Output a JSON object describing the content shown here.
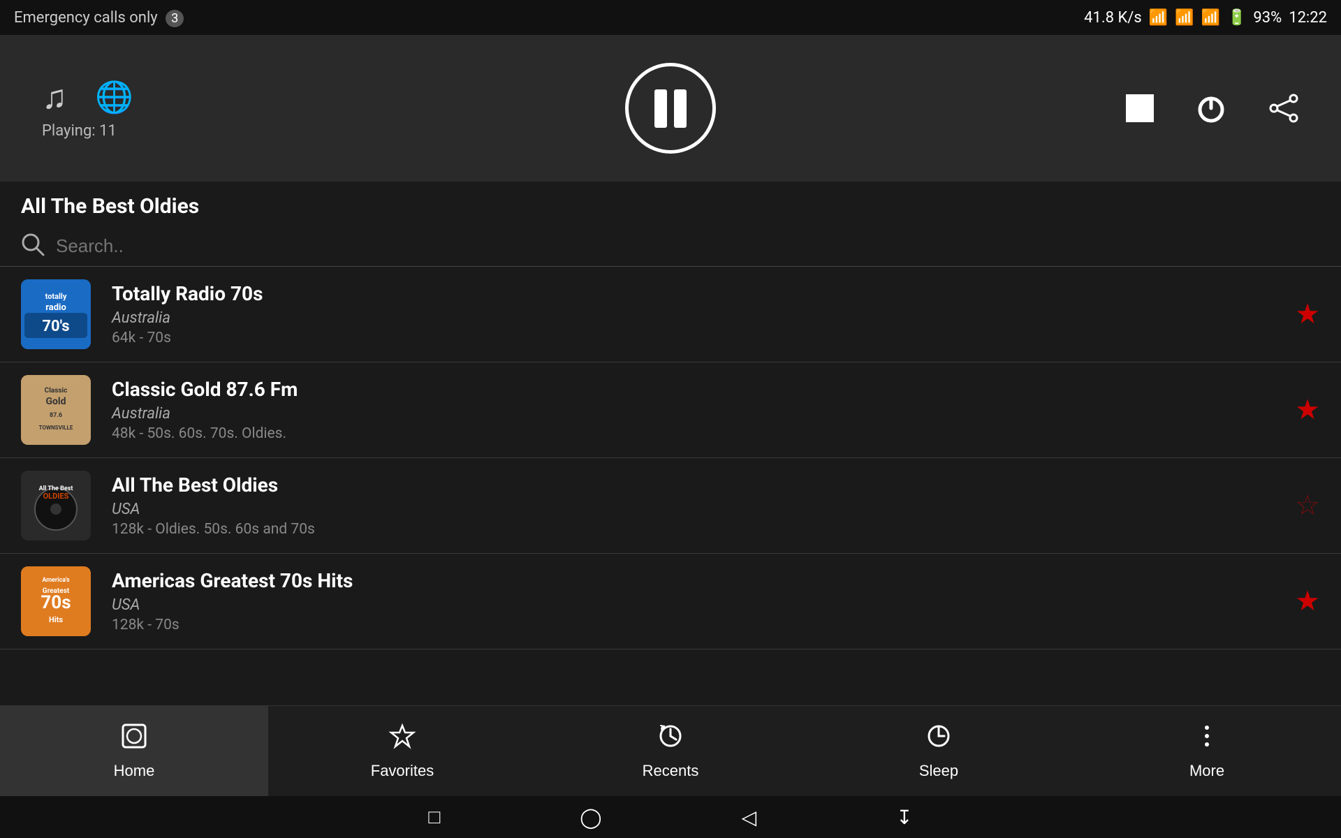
{
  "statusBar": {
    "emergencyText": "Emergency calls only",
    "notificationCount": "3",
    "rightInfo": "41.8 K/s",
    "batteryPercent": "93%",
    "time": "12:22"
  },
  "player": {
    "nowPlayingLabel": "Playing: 11",
    "stationTitle": "All The Best Oldies"
  },
  "search": {
    "placeholder": "Search.."
  },
  "stations": [
    {
      "name": "Totally Radio 70s",
      "country": "Australia",
      "details": "64k - 70s",
      "favorited": true,
      "logoText": "totally\nradio\n70's",
      "logoClass": "logo-70s"
    },
    {
      "name": "Classic Gold 87.6 Fm",
      "country": "Australia",
      "details": "48k - 50s. 60s. 70s. Oldies.",
      "favorited": true,
      "logoText": "Classic\nGold\nTOWNSVILLE",
      "logoClass": "logo-classic"
    },
    {
      "name": "All The Best Oldies",
      "country": "USA",
      "details": "128k - Oldies. 50s. 60s and 70s",
      "favorited": false,
      "logoText": "All The Best\nOLDIES",
      "logoClass": "logo-oldies"
    },
    {
      "name": "Americas Greatest 70s Hits",
      "country": "USA",
      "details": "128k - 70s",
      "favorited": true,
      "logoText": "America's\n70s\nHits",
      "logoClass": "logo-americas"
    }
  ],
  "bottomNav": [
    {
      "id": "home",
      "label": "Home",
      "icon": "⊟",
      "active": true
    },
    {
      "id": "favorites",
      "label": "Favorites",
      "icon": "☆",
      "active": false
    },
    {
      "id": "recents",
      "label": "Recents",
      "icon": "↺",
      "active": false
    },
    {
      "id": "sleep",
      "label": "Sleep",
      "icon": "◷",
      "active": false
    },
    {
      "id": "more",
      "label": "More",
      "icon": "⋮",
      "active": false
    }
  ],
  "sysNav": {
    "squareLabel": "□",
    "circleLabel": "○",
    "backLabel": "◁",
    "downloadLabel": "⤓"
  }
}
